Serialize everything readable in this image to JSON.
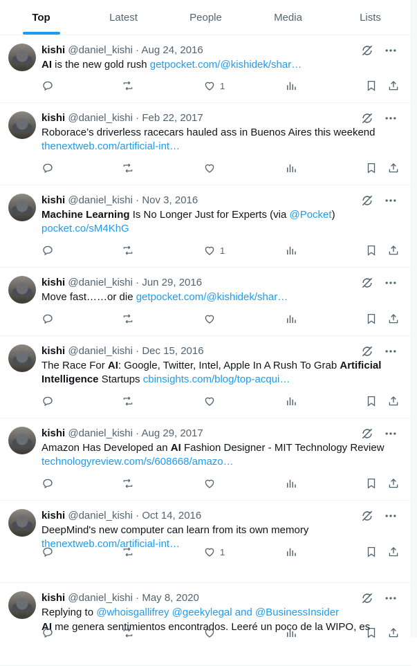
{
  "tabs": [
    {
      "label": "Top",
      "active": true
    },
    {
      "label": "Latest",
      "active": false
    },
    {
      "label": "People",
      "active": false
    },
    {
      "label": "Media",
      "active": false
    },
    {
      "label": "Lists",
      "active": false
    }
  ],
  "colors": {
    "accent": "#1d9bf0",
    "muted": "#536471",
    "text": "#0f1419",
    "divider": "#eff3f4"
  },
  "tweets": [
    {
      "name": "kishi",
      "handle": "@daniel_kishi",
      "date": "Aug 24, 2016",
      "parts": [
        {
          "t": "AI",
          "b": true
        },
        {
          "t": " is the new gold rush "
        },
        {
          "t": "getpocket.com/@kishidek/shar…",
          "l": true
        }
      ],
      "likes": "1"
    },
    {
      "name": "kishi",
      "handle": "@daniel_kishi",
      "date": "Feb 22, 2017",
      "parts": [
        {
          "t": "Roborace’s driverless racecars hauled ass in Buenos Aires this weekend "
        },
        {
          "t": "thenextweb.com/artificial-int…",
          "l": true
        }
      ],
      "likes": ""
    },
    {
      "name": "kishi",
      "handle": "@daniel_kishi",
      "date": "Nov 3, 2016",
      "parts": [
        {
          "t": "Machine Learning",
          "b": true
        },
        {
          "t": " Is No Longer Just for Experts (via "
        },
        {
          "t": "@Pocket",
          "l": true
        },
        {
          "t": ") "
        },
        {
          "t": "pocket.co/sM4KhG",
          "l": true
        }
      ],
      "likes": "1"
    },
    {
      "name": "kishi",
      "handle": "@daniel_kishi",
      "date": "Jun 29, 2016",
      "parts": [
        {
          "t": "Move fast……or die "
        },
        {
          "t": "getpocket.com/@kishidek/shar…",
          "l": true
        }
      ],
      "likes": ""
    },
    {
      "name": "kishi",
      "handle": "@daniel_kishi",
      "date": "Dec 15, 2016",
      "parts": [
        {
          "t": "The Race For "
        },
        {
          "t": "AI",
          "b": true
        },
        {
          "t": ": Google, Twitter, Intel, Apple In A Rush To Grab "
        },
        {
          "t": "Artificial Intelligence",
          "b": true
        },
        {
          "t": " Startups "
        },
        {
          "t": "cbinsights.com/blog/top-acqui…",
          "l": true
        }
      ],
      "likes": ""
    },
    {
      "name": "kishi",
      "handle": "@daniel_kishi",
      "date": "Aug 29, 2017",
      "parts": [
        {
          "t": "Amazon Has Developed an "
        },
        {
          "t": "AI",
          "b": true
        },
        {
          "t": " Fashion Designer - MIT Technology Review "
        },
        {
          "t": "technologyreview.com/s/608668/amazo…",
          "l": true
        }
      ],
      "likes": ""
    },
    {
      "name": "kishi",
      "handle": "@daniel_kishi",
      "date": "Oct 14, 2016",
      "parts": [
        {
          "t": "DeepMind's new computer can learn from its own memory "
        },
        {
          "t": "thenextweb.com/artificial-int…",
          "l": true
        }
      ],
      "likes": "1"
    },
    {
      "name": "kishi",
      "handle": "@daniel_kishi",
      "date": "May 8, 2020",
      "replying": "Replying to ",
      "reply_to": "@whoisgallifrey @geekylegal and @BusinessInsider",
      "parts": [
        {
          "t": "AI",
          "b": true
        },
        {
          "t": " me genera sentimientos encontrados. Leeré un poco de la WIPO, es"
        }
      ],
      "likes": ""
    }
  ]
}
